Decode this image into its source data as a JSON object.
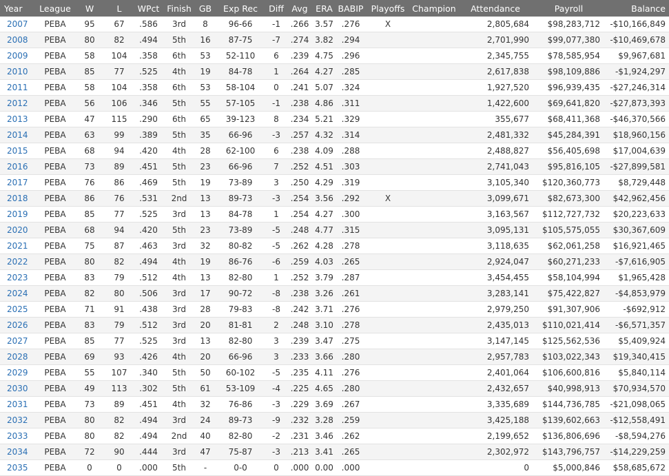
{
  "columns": [
    "Year",
    "League",
    "W",
    "L",
    "WPct",
    "Finish",
    "GB",
    "Exp Rec",
    "Diff",
    "Avg",
    "ERA",
    "BABIP",
    "Playoffs",
    "Champion",
    "Attendance",
    "Payroll",
    "Balance"
  ],
  "rows": [
    [
      "2007",
      "PEBA",
      "95",
      "67",
      ".586",
      "3rd",
      "8",
      "96-66",
      "-1",
      ".266",
      "3.57",
      ".276",
      "X",
      "",
      "2,805,684",
      "$98,283,712",
      "-$10,166,849"
    ],
    [
      "2008",
      "PEBA",
      "80",
      "82",
      ".494",
      "5th",
      "16",
      "87-75",
      "-7",
      ".274",
      "3.82",
      ".294",
      "",
      "",
      "2,701,990",
      "$99,077,380",
      "-$10,469,678"
    ],
    [
      "2009",
      "PEBA",
      "58",
      "104",
      ".358",
      "6th",
      "53",
      "52-110",
      "6",
      ".239",
      "4.75",
      ".296",
      "",
      "",
      "2,345,755",
      "$78,585,954",
      "$9,967,681"
    ],
    [
      "2010",
      "PEBA",
      "85",
      "77",
      ".525",
      "4th",
      "19",
      "84-78",
      "1",
      ".264",
      "4.27",
      ".285",
      "",
      "",
      "2,617,838",
      "$98,109,886",
      "-$1,924,297"
    ],
    [
      "2011",
      "PEBA",
      "58",
      "104",
      ".358",
      "6th",
      "53",
      "58-104",
      "0",
      ".241",
      "5.07",
      ".324",
      "",
      "",
      "1,927,520",
      "$96,939,435",
      "-$27,246,314"
    ],
    [
      "2012",
      "PEBA",
      "56",
      "106",
      ".346",
      "5th",
      "55",
      "57-105",
      "-1",
      ".238",
      "4.86",
      ".311",
      "",
      "",
      "1,422,600",
      "$69,641,820",
      "-$27,873,393"
    ],
    [
      "2013",
      "PEBA",
      "47",
      "115",
      ".290",
      "6th",
      "65",
      "39-123",
      "8",
      ".234",
      "5.21",
      ".329",
      "",
      "",
      "355,677",
      "$68,411,368",
      "-$46,370,566"
    ],
    [
      "2014",
      "PEBA",
      "63",
      "99",
      ".389",
      "5th",
      "35",
      "66-96",
      "-3",
      ".257",
      "4.32",
      ".314",
      "",
      "",
      "2,481,332",
      "$45,284,391",
      "$18,960,156"
    ],
    [
      "2015",
      "PEBA",
      "68",
      "94",
      ".420",
      "4th",
      "28",
      "62-100",
      "6",
      ".238",
      "4.09",
      ".288",
      "",
      "",
      "2,488,827",
      "$56,405,698",
      "$17,004,639"
    ],
    [
      "2016",
      "PEBA",
      "73",
      "89",
      ".451",
      "5th",
      "23",
      "66-96",
      "7",
      ".252",
      "4.51",
      ".303",
      "",
      "",
      "2,741,043",
      "$95,816,105",
      "-$27,899,581"
    ],
    [
      "2017",
      "PEBA",
      "76",
      "86",
      ".469",
      "5th",
      "19",
      "73-89",
      "3",
      ".250",
      "4.29",
      ".319",
      "",
      "",
      "3,105,340",
      "$120,360,773",
      "$8,729,448"
    ],
    [
      "2018",
      "PEBA",
      "86",
      "76",
      ".531",
      "2nd",
      "13",
      "89-73",
      "-3",
      ".254",
      "3.56",
      ".292",
      "X",
      "",
      "3,099,671",
      "$82,673,300",
      "$42,962,456"
    ],
    [
      "2019",
      "PEBA",
      "85",
      "77",
      ".525",
      "3rd",
      "13",
      "84-78",
      "1",
      ".254",
      "4.27",
      ".300",
      "",
      "",
      "3,163,567",
      "$112,727,732",
      "$20,223,633"
    ],
    [
      "2020",
      "PEBA",
      "68",
      "94",
      ".420",
      "5th",
      "23",
      "73-89",
      "-5",
      ".248",
      "4.77",
      ".315",
      "",
      "",
      "3,095,131",
      "$105,575,055",
      "$30,367,609"
    ],
    [
      "2021",
      "PEBA",
      "75",
      "87",
      ".463",
      "3rd",
      "32",
      "80-82",
      "-5",
      ".262",
      "4.28",
      ".278",
      "",
      "",
      "3,118,635",
      "$62,061,258",
      "$16,921,465"
    ],
    [
      "2022",
      "PEBA",
      "80",
      "82",
      ".494",
      "4th",
      "19",
      "86-76",
      "-6",
      ".259",
      "4.03",
      ".265",
      "",
      "",
      "2,924,047",
      "$60,271,233",
      "-$7,616,905"
    ],
    [
      "2023",
      "PEBA",
      "83",
      "79",
      ".512",
      "4th",
      "13",
      "82-80",
      "1",
      ".252",
      "3.79",
      ".287",
      "",
      "",
      "3,454,455",
      "$58,104,994",
      "$1,965,428"
    ],
    [
      "2024",
      "PEBA",
      "82",
      "80",
      ".506",
      "3rd",
      "17",
      "90-72",
      "-8",
      ".238",
      "3.26",
      ".261",
      "",
      "",
      "3,283,141",
      "$75,422,827",
      "-$4,853,979"
    ],
    [
      "2025",
      "PEBA",
      "71",
      "91",
      ".438",
      "3rd",
      "28",
      "79-83",
      "-8",
      ".242",
      "3.71",
      ".276",
      "",
      "",
      "2,979,250",
      "$91,307,906",
      "-$692,912"
    ],
    [
      "2026",
      "PEBA",
      "83",
      "79",
      ".512",
      "3rd",
      "20",
      "81-81",
      "2",
      ".248",
      "3.10",
      ".278",
      "",
      "",
      "2,435,013",
      "$110,021,414",
      "-$6,571,357"
    ],
    [
      "2027",
      "PEBA",
      "85",
      "77",
      ".525",
      "3rd",
      "13",
      "82-80",
      "3",
      ".239",
      "3.47",
      ".275",
      "",
      "",
      "3,147,145",
      "$125,562,536",
      "$5,409,924"
    ],
    [
      "2028",
      "PEBA",
      "69",
      "93",
      ".426",
      "4th",
      "20",
      "66-96",
      "3",
      ".233",
      "3.66",
      ".280",
      "",
      "",
      "2,957,783",
      "$103,022,343",
      "$19,340,415"
    ],
    [
      "2029",
      "PEBA",
      "55",
      "107",
      ".340",
      "5th",
      "50",
      "60-102",
      "-5",
      ".235",
      "4.11",
      ".276",
      "",
      "",
      "2,401,064",
      "$106,600,816",
      "$5,840,114"
    ],
    [
      "2030",
      "PEBA",
      "49",
      "113",
      ".302",
      "5th",
      "61",
      "53-109",
      "-4",
      ".225",
      "4.65",
      ".280",
      "",
      "",
      "2,432,657",
      "$40,998,913",
      "$70,934,570"
    ],
    [
      "2031",
      "PEBA",
      "73",
      "89",
      ".451",
      "4th",
      "32",
      "76-86",
      "-3",
      ".229",
      "3.69",
      ".267",
      "",
      "",
      "3,335,689",
      "$144,736,785",
      "-$21,098,065"
    ],
    [
      "2032",
      "PEBA",
      "80",
      "82",
      ".494",
      "3rd",
      "24",
      "89-73",
      "-9",
      ".232",
      "3.28",
      ".259",
      "",
      "",
      "3,425,188",
      "$139,602,663",
      "-$12,558,491"
    ],
    [
      "2033",
      "PEBA",
      "80",
      "82",
      ".494",
      "2nd",
      "40",
      "82-80",
      "-2",
      ".231",
      "3.46",
      ".262",
      "",
      "",
      "2,199,652",
      "$136,806,696",
      "-$8,594,276"
    ],
    [
      "2034",
      "PEBA",
      "72",
      "90",
      ".444",
      "3rd",
      "47",
      "75-87",
      "-3",
      ".213",
      "3.41",
      ".265",
      "",
      "",
      "2,302,972",
      "$143,796,757",
      "-$14,229,259"
    ],
    [
      "2035",
      "PEBA",
      "0",
      "0",
      ".000",
      "5th",
      "-",
      "0-0",
      "0",
      ".000",
      "0.00",
      ".000",
      "",
      "",
      "0",
      "$5,000,846",
      "$58,685,672"
    ]
  ]
}
